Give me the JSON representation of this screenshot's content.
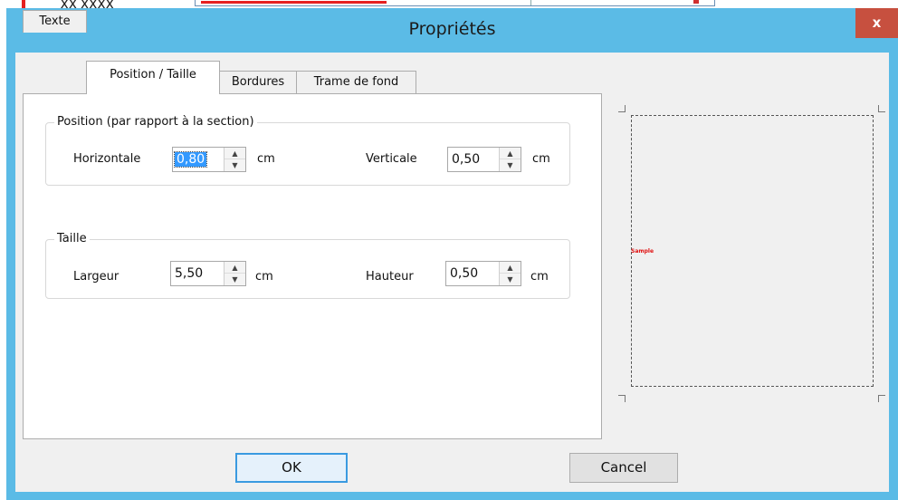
{
  "background": {
    "fragment_text": "XX XXXX"
  },
  "dialog": {
    "title": "Propriétés",
    "close_glyph": "x",
    "tabs": [
      {
        "label": "Texte",
        "active": false
      },
      {
        "label": "Position / Taille",
        "active": true
      },
      {
        "label": "Bordures",
        "active": false
      },
      {
        "label": "Trame de fond",
        "active": false
      }
    ],
    "position_group": {
      "label": "Position (par rapport à la section)",
      "horizontal": {
        "label": "Horizontale",
        "value": "0,80",
        "unit": "cm"
      },
      "vertical": {
        "label": "Verticale",
        "value": "0,50",
        "unit": "cm"
      }
    },
    "size_group": {
      "label": "Taille",
      "width": {
        "label": "Largeur",
        "value": "5,50",
        "unit": "cm"
      },
      "height": {
        "label": "Hauteur",
        "value": "0,50",
        "unit": "cm"
      }
    },
    "preview": {
      "sample_text": "Sample"
    },
    "buttons": {
      "ok": "OK",
      "cancel": "Cancel"
    }
  },
  "colors": {
    "frame": "#5bbbe6",
    "close": "#c7503f",
    "selection": "#3399ff",
    "sample_text": "#e01010"
  }
}
